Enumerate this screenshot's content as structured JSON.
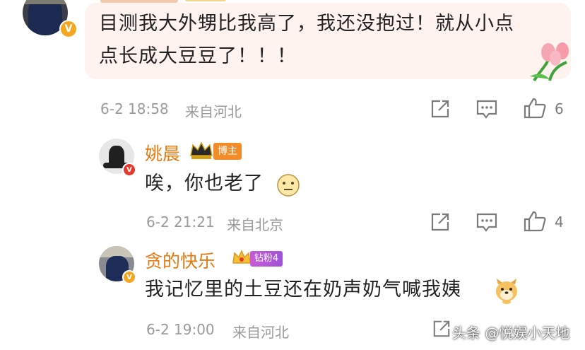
{
  "comments": [
    {
      "text_line1": "目测我大外甥比我高了，我还没抱过！就从小点",
      "text_line2": "点长成大豆豆了！！！",
      "date": "6-2 18:58",
      "location": "来自河北",
      "likes": "6"
    }
  ],
  "replies": [
    {
      "username": "姚晨",
      "badge": "博主",
      "text": "唉，你也老了",
      "date": "6-2 21:21",
      "location": "来自北京",
      "likes": "4"
    },
    {
      "username": "贪的快乐",
      "badge": "钻粉4",
      "text": "我记忆里的土豆还在奶声奶气喊我姨",
      "date": "6-2 19:00",
      "location": "来自河北"
    }
  ],
  "watermark": "头条 @悦娱小天地",
  "colors": {
    "username": "#e8790f",
    "meta": "#9a9a9a",
    "text": "#222222",
    "bubble": "#fff3f0",
    "verified": "#f5a623",
    "verified_red": "#e8392f"
  },
  "icons": [
    "share-icon",
    "comment-icon",
    "like-icon",
    "verified-icon",
    "crown-icon",
    "neutral-face-emoji",
    "dog-emoji",
    "tulip-sticker"
  ]
}
